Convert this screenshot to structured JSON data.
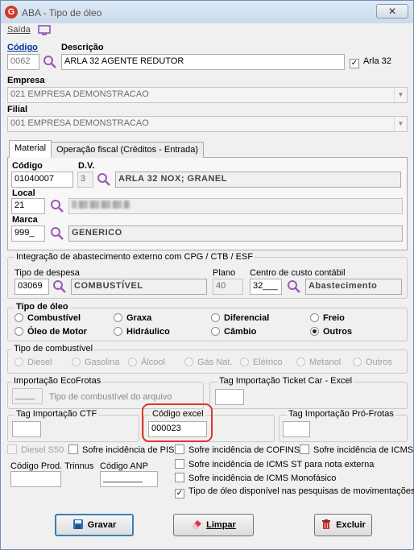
{
  "window": {
    "title": "ABA - Tipo de óleo",
    "close_glyph": "✕",
    "logo_letter": "G"
  },
  "menu": {
    "saida": "Saída"
  },
  "header": {
    "codigo_label": "Código",
    "codigo_value": "0062",
    "descricao_label": "Descrição",
    "descricao_value": "ARLA 32 AGENTE REDUTOR",
    "arla_label": "Arla 32",
    "arla_checked": "✓",
    "empresa_label": "Empresa",
    "empresa_value": "021 EMPRESA DEMONSTRACAO",
    "filial_label": "Filial",
    "filial_value": "001 EMPRESA DEMONSTRACAO"
  },
  "tabs": [
    {
      "label": "Material"
    },
    {
      "label": "Operação fiscal (Créditos - Entrada)"
    }
  ],
  "material": {
    "codigo_label": "Código",
    "codigo_value": "01040007",
    "dv_label": "D.V.",
    "dv_value": "3",
    "material_desc": "ARLA 32 NOX; GRANEL",
    "local_label": "Local",
    "local_value": "21",
    "marca_label": "Marca",
    "marca_value": "999_",
    "marca_desc": "GENERICO"
  },
  "integracao": {
    "title": "Integração de abastecimento externo com CPG / CTB / ESF",
    "tipo_despesa_label": "Tipo de despesa",
    "tipo_despesa_code": "03069",
    "tipo_despesa_desc": "COMBUSTÍVEL",
    "plano_label": "Plano",
    "plano_value": "40",
    "centro_label": "Centro de custo contábil",
    "centro_code": "32___",
    "centro_desc": "Abastecimento"
  },
  "tipo_oleo": {
    "title": "Tipo de óleo",
    "options": [
      "Combustível",
      "Graxa",
      "Diferencial",
      "Freio",
      "Óleo de Motor",
      "Hidráulico",
      "Câmbio",
      "Outros"
    ],
    "selected": "Outros"
  },
  "tipo_combustivel": {
    "title": "Tipo de combustível",
    "options": [
      "Diesel",
      "Gasolina",
      "Álcool",
      "Gás Nat.",
      "Elétrico",
      "Metanol",
      "Outros"
    ]
  },
  "importacao_ecofrotas": {
    "title": "Importação EcoFrotas",
    "field_value": "____",
    "hint": "Tipo de combustível do arquivo"
  },
  "tag_ticket": {
    "title": "Tag Importação Ticket Car - Excel"
  },
  "tag_ctf": {
    "title": "Tag Importação CTF"
  },
  "codigo_excel": {
    "title": "Código excel",
    "value": "000023"
  },
  "tag_pro_frotas": {
    "title": "Tag Importação Pró-Frotas"
  },
  "checks": {
    "diesel_s50": "Diesel S50",
    "pis": "Sofre incidência de PIS",
    "cofins": "Sofre incidência de COFINS",
    "icms": "Sofre incidência de ICMS",
    "icms_st": "Sofre incidência de ICMS ST para nota externa",
    "icms_mono": "Sofre incidência de ICMS Monofásico",
    "disponivel": "Tipo de óleo disponível nas pesquisas de movimentações",
    "disponivel_checked": "✓"
  },
  "trinnus": {
    "label": "Código Prod. Trinnus"
  },
  "anp": {
    "label": "Código ANP",
    "value": "________"
  },
  "buttons": {
    "gravar": "Gravar",
    "limpar": "Limpar",
    "excluir": "Excluir"
  },
  "colors": {
    "accent": "#3c7fb1",
    "magnifier": "#9b59b6",
    "logo": "#d6352a"
  }
}
